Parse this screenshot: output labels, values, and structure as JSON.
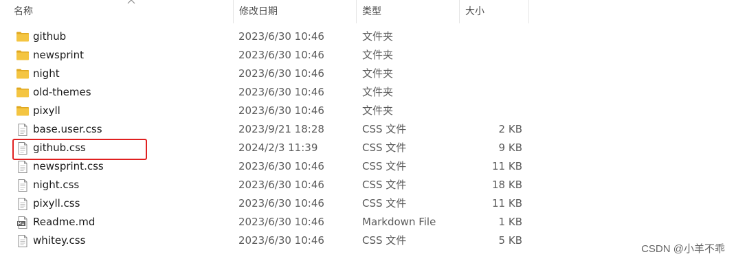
{
  "columns": {
    "name": "名称",
    "date": "修改日期",
    "type": "类型",
    "size": "大小"
  },
  "files": [
    {
      "icon": "folder-icon",
      "name": "github",
      "date": "2023/6/30 10:46",
      "type": "文件夹",
      "size": ""
    },
    {
      "icon": "folder-icon",
      "name": "newsprint",
      "date": "2023/6/30 10:46",
      "type": "文件夹",
      "size": ""
    },
    {
      "icon": "folder-icon",
      "name": "night",
      "date": "2023/6/30 10:46",
      "type": "文件夹",
      "size": ""
    },
    {
      "icon": "folder-icon",
      "name": "old-themes",
      "date": "2023/6/30 10:46",
      "type": "文件夹",
      "size": ""
    },
    {
      "icon": "folder-icon",
      "name": "pixyll",
      "date": "2023/6/30 10:46",
      "type": "文件夹",
      "size": ""
    },
    {
      "icon": "file-icon",
      "name": "base.user.css",
      "date": "2023/9/21 18:28",
      "type": "CSS 文件",
      "size": "2 KB"
    },
    {
      "icon": "file-icon",
      "name": "github.css",
      "date": "2024/2/3 11:39",
      "type": "CSS 文件",
      "size": "9 KB"
    },
    {
      "icon": "file-icon",
      "name": "newsprint.css",
      "date": "2023/6/30 10:46",
      "type": "CSS 文件",
      "size": "11 KB"
    },
    {
      "icon": "file-icon",
      "name": "night.css",
      "date": "2023/6/30 10:46",
      "type": "CSS 文件",
      "size": "18 KB"
    },
    {
      "icon": "file-icon",
      "name": "pixyll.css",
      "date": "2023/6/30 10:46",
      "type": "CSS 文件",
      "size": "11 KB"
    },
    {
      "icon": "markdown-icon",
      "name": "Readme.md",
      "date": "2023/6/30 10:46",
      "type": "Markdown File",
      "size": "1 KB"
    },
    {
      "icon": "file-icon",
      "name": "whitey.css",
      "date": "2023/6/30 10:46",
      "type": "CSS 文件",
      "size": "5 KB"
    }
  ],
  "highlighted_file": "github.css",
  "colors": {
    "highlight": "#e02020",
    "folder": "#f4c542",
    "folder_dark": "#e0a820"
  },
  "watermark": "CSDN @小羊不乖"
}
